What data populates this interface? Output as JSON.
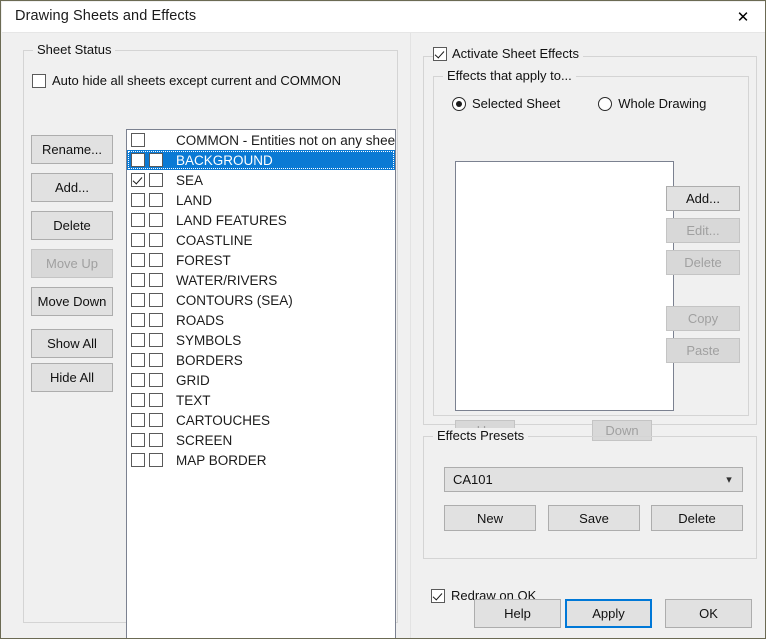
{
  "window": {
    "title": "Drawing Sheets and Effects",
    "close_icon": "close-icon"
  },
  "left_panel": {
    "group_title": "Sheet Status",
    "auto_hide": {
      "label": "Auto hide all sheets except current and COMMON",
      "checked": false
    },
    "buttons": [
      {
        "label": "Rename...",
        "enabled": true
      },
      {
        "label": "Add...",
        "enabled": true
      },
      {
        "label": "Delete",
        "enabled": true
      },
      {
        "label": "Move Up",
        "enabled": false
      },
      {
        "label": "Move Down",
        "enabled": true
      },
      {
        "label": "Show All",
        "enabled": true
      },
      {
        "label": "Hide All",
        "enabled": true
      }
    ],
    "sheets": [
      {
        "label": "COMMON - Entities not on any sheet",
        "cb1": false,
        "cb2": null,
        "selected": false
      },
      {
        "label": "BACKGROUND",
        "cb1": false,
        "cb2": false,
        "selected": true
      },
      {
        "label": "SEA",
        "cb1": true,
        "cb2": false,
        "selected": false
      },
      {
        "label": "LAND",
        "cb1": false,
        "cb2": false,
        "selected": false
      },
      {
        "label": "LAND FEATURES",
        "cb1": false,
        "cb2": false,
        "selected": false
      },
      {
        "label": "COASTLINE",
        "cb1": false,
        "cb2": false,
        "selected": false
      },
      {
        "label": "FOREST",
        "cb1": false,
        "cb2": false,
        "selected": false
      },
      {
        "label": "WATER/RIVERS",
        "cb1": false,
        "cb2": false,
        "selected": false
      },
      {
        "label": "CONTOURS (SEA)",
        "cb1": false,
        "cb2": false,
        "selected": false
      },
      {
        "label": "ROADS",
        "cb1": false,
        "cb2": false,
        "selected": false
      },
      {
        "label": "SYMBOLS",
        "cb1": false,
        "cb2": false,
        "selected": false
      },
      {
        "label": "BORDERS",
        "cb1": false,
        "cb2": false,
        "selected": false
      },
      {
        "label": "GRID",
        "cb1": false,
        "cb2": false,
        "selected": false
      },
      {
        "label": "TEXT",
        "cb1": false,
        "cb2": false,
        "selected": false
      },
      {
        "label": "CARTOUCHES",
        "cb1": false,
        "cb2": false,
        "selected": false
      },
      {
        "label": "SCREEN",
        "cb1": false,
        "cb2": false,
        "selected": false
      },
      {
        "label": "MAP BORDER",
        "cb1": false,
        "cb2": false,
        "selected": false
      }
    ]
  },
  "right_panel": {
    "activate_effects": {
      "label": "Activate Sheet Effects",
      "checked": true
    },
    "effects_apply_group_title": "Effects that apply to...",
    "radios": [
      {
        "label": "Selected Sheet",
        "selected": true
      },
      {
        "label": "Whole Drawing",
        "selected": false
      }
    ],
    "effect_buttons": [
      {
        "label": "Add...",
        "enabled": true
      },
      {
        "label": "Edit...",
        "enabled": false
      },
      {
        "label": "Delete",
        "enabled": false
      },
      {
        "label": "Copy",
        "enabled": false
      },
      {
        "label": "Paste",
        "enabled": false
      }
    ],
    "order_buttons": [
      {
        "label": "Up",
        "enabled": false
      },
      {
        "label": "Down",
        "enabled": false
      }
    ],
    "presets": {
      "group_title": "Effects Presets",
      "selected": "CA101",
      "chevron_icon": "chevron-down-icon",
      "buttons": [
        {
          "label": "New",
          "enabled": true
        },
        {
          "label": "Save",
          "enabled": true
        },
        {
          "label": "Delete",
          "enabled": true
        }
      ]
    },
    "redraw_on_ok": {
      "label": "Redraw on OK",
      "checked": true
    },
    "dialog_buttons": [
      {
        "label": "Help",
        "enabled": true,
        "focused": false
      },
      {
        "label": "Apply",
        "enabled": true,
        "focused": true
      },
      {
        "label": "OK",
        "enabled": true,
        "focused": false
      }
    ]
  },
  "colors": {
    "selection_blue": "#0b7ad4",
    "focus_blue": "#0078d7",
    "dialog_bg": "#f0f0f0",
    "list_bg": "#ffffff"
  }
}
